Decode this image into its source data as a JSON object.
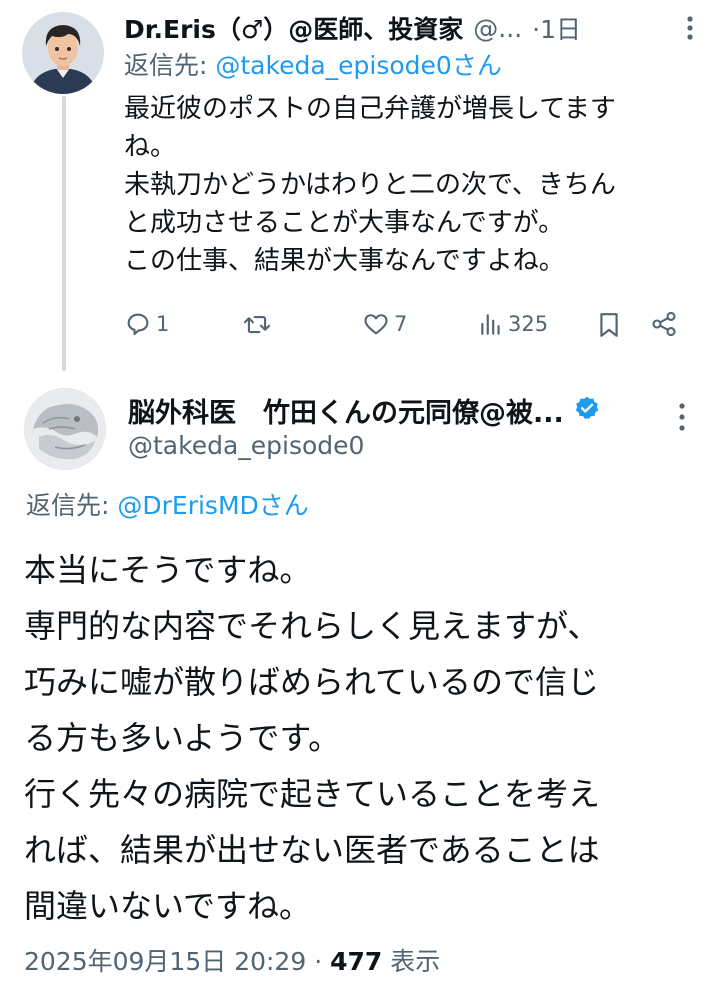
{
  "reply_tweet": {
    "author_name": "Dr.Eris（♂）@医師、投資家",
    "handle": "@...",
    "time": "·1日",
    "reply_to_prefix": "返信先: ",
    "reply_to_mention": "@takeda_episode0さん",
    "body_lines": [
      "最近彼のポストの自己弁護が増長してます",
      "ね。",
      "未執刀かどうかはわりと二の次で、きちん",
      "と成功させることが大事なんですが。",
      "この仕事、結果が大事なんですよね。"
    ],
    "actions": {
      "reply_count": "1",
      "retweet_count": "",
      "like_count": "7",
      "view_count": "325"
    }
  },
  "main_tweet": {
    "author_name": "脳外科医　竹田くんの元同僚@被...",
    "handle": "@takeda_episode0",
    "reply_to_prefix": "返信先: ",
    "reply_to_mention": "@DrErisMDさん",
    "body_lines": [
      "本当にそうですね。",
      "専門的な内容でそれらしく見えますが、",
      "巧みに嘘が散りばめられているので信じ",
      "る方も多いようです。",
      "行く先々の病院で起きていることを考え",
      "れば、結果が出せない医者であることは",
      "間違いないですね。"
    ],
    "timestamp": "2025年09月15日 20:29",
    "separator": " · ",
    "views": "477",
    "views_label": " 表示"
  },
  "colors": {
    "text": "#0f1419",
    "secondary": "#536471",
    "link": "#1d9bf0",
    "thread_line": "#cfd9de"
  },
  "icons": [
    "more-vert-icon",
    "reply-icon",
    "retweet-icon",
    "like-icon",
    "views-icon",
    "bookmark-icon",
    "share-icon",
    "verified-badge-icon"
  ]
}
